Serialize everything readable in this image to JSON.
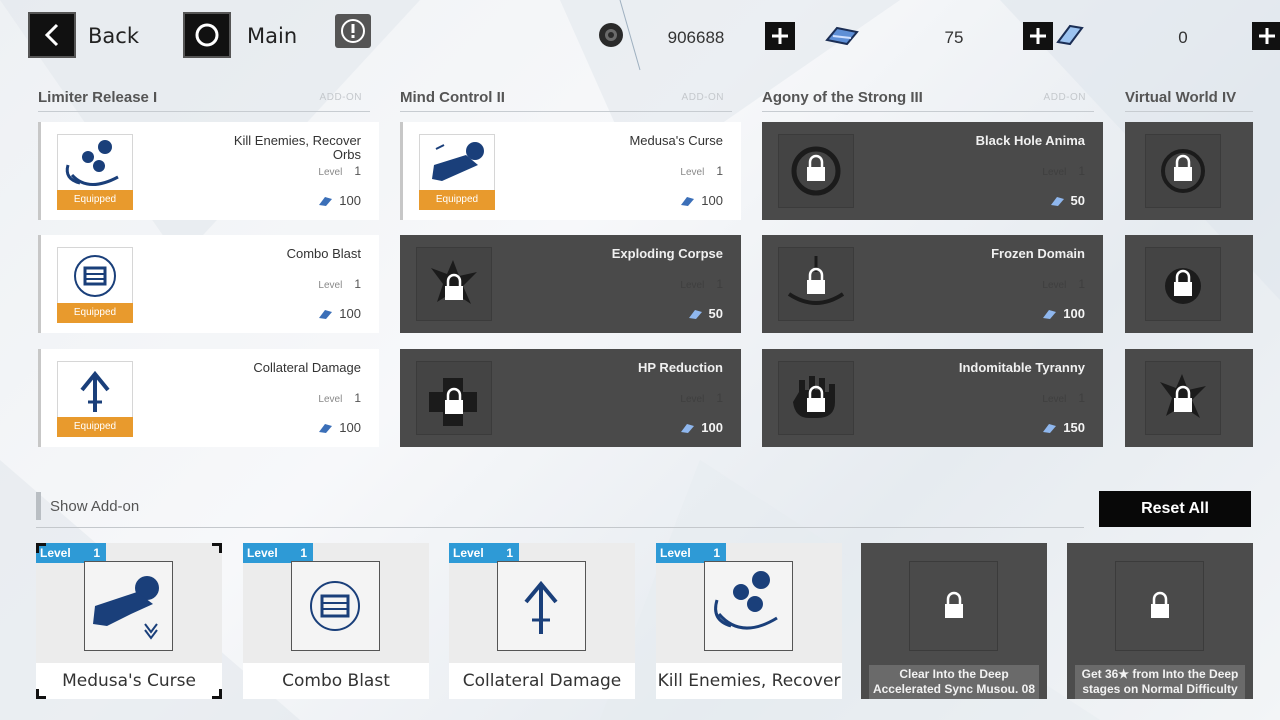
{
  "nav": {
    "back_label": "Back",
    "main_label": "Main"
  },
  "currencies": [
    {
      "icon": "gear-coin-icon",
      "value": "906688"
    },
    {
      "icon": "blue-chip-icon",
      "value": "75"
    },
    {
      "icon": "blue-card-icon",
      "value": "0"
    }
  ],
  "columns": [
    {
      "title": "Limiter Release I",
      "addon": "ADD-ON"
    },
    {
      "title": "Mind Control II",
      "addon": "ADD-ON"
    },
    {
      "title": "Agony of the Strong III",
      "addon": "ADD-ON"
    },
    {
      "title": "Virtual World IV",
      "addon": ""
    }
  ],
  "cards": {
    "col1": [
      {
        "name": "Kill Enemies, Recover Orbs",
        "level_label": "Level",
        "level": "1",
        "cost": "100",
        "status": "Equipped",
        "icon": "orbs-icon"
      },
      {
        "name": "Combo Blast",
        "level_label": "Level",
        "level": "1",
        "cost": "100",
        "status": "Equipped",
        "icon": "combo-blast-icon"
      },
      {
        "name": "Collateral Damage",
        "level_label": "Level",
        "level": "1",
        "cost": "100",
        "status": "Equipped",
        "icon": "arrow-up-icon"
      }
    ],
    "col2": [
      {
        "name": "Medusa's Curse",
        "level_label": "Level",
        "level": "1",
        "cost": "100",
        "status": "Equipped",
        "icon": "crouching-figure-icon"
      },
      {
        "name": "Exploding Corpse",
        "level_label": "Level",
        "level": "1",
        "cost": "50",
        "icon": "lock-icon"
      },
      {
        "name": "HP Reduction",
        "level_label": "Level",
        "level": "1",
        "cost": "100",
        "icon": "lock-icon"
      }
    ],
    "col3": [
      {
        "name": "Black Hole Anima",
        "level_label": "Level",
        "level": "1",
        "cost": "50",
        "icon": "lock-icon"
      },
      {
        "name": "Frozen Domain",
        "level_label": "Level",
        "level": "1",
        "cost": "100",
        "icon": "lock-icon"
      },
      {
        "name": "Indomitable Tyranny",
        "level_label": "Level",
        "level": "1",
        "cost": "150",
        "icon": "lock-icon"
      }
    ]
  },
  "addon": {
    "label": "Show Add-on",
    "reset_label": "Reset All"
  },
  "slots": [
    {
      "level_label": "Level",
      "level": "1",
      "name": "Medusa's Curse"
    },
    {
      "level_label": "Level",
      "level": "1",
      "name": "Combo Blast"
    },
    {
      "level_label": "Level",
      "level": "1",
      "name": "Collateral Damage"
    },
    {
      "level_label": "Level",
      "level": "1",
      "name": "Kill Enemies, Recover"
    },
    {
      "requirement": "Clear Into the Deep\nAccelerated Sync Musou. 08"
    },
    {
      "requirement": "Get 36★ from Into the Deep\nstages on Normal Difficulty"
    }
  ],
  "colors": {
    "equipped": "#e89a2d",
    "level_tab": "#2e9ad6",
    "locked_card": "#4a4a4a",
    "icon_blue": "#1a3f7a"
  }
}
